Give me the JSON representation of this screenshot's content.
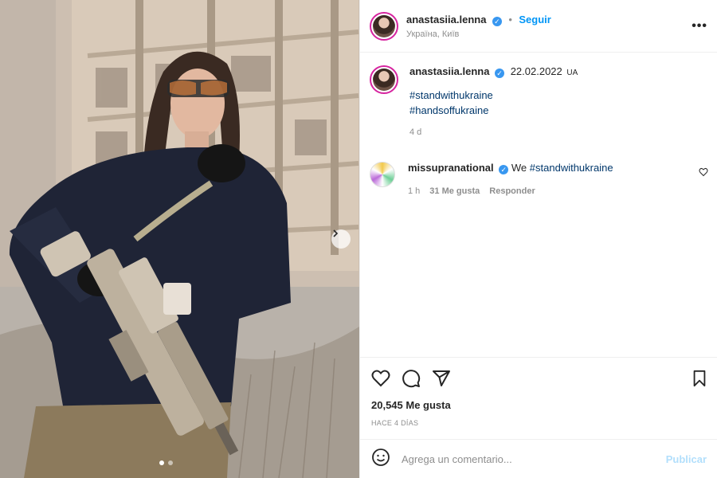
{
  "header": {
    "username": "anastasiia.lenna",
    "separator": "•",
    "follow_label": "Seguir",
    "location": "Україна, Київ",
    "more_label": "•••"
  },
  "caption": {
    "username": "anastasiia.lenna",
    "date": "22.02.2022",
    "flag": "UA",
    "hashtags": [
      "#standwithukraine",
      "#handsoffukraine"
    ],
    "age": "4 d"
  },
  "comment": {
    "username": "missupranational",
    "text_prefix": "We ",
    "hashtag": "#standwithukraine",
    "time": "1 h",
    "likes": "31 Me gusta",
    "reply_label": "Responder"
  },
  "actions": {
    "like_icon": "heart-icon",
    "comment_icon": "comment-icon",
    "share_icon": "share-icon",
    "save_icon": "bookmark-icon"
  },
  "stats": {
    "likes": "20,545 Me gusta",
    "posted": "HACE 4 DÍAS"
  },
  "add_comment": {
    "placeholder": "Agrega un comentario...",
    "post_label": "Publicar",
    "emoji_icon": "emoji-icon"
  },
  "media": {
    "carousel_dots": 2,
    "active_dot": 0
  },
  "colors": {
    "accent": "#0095f6",
    "verified": "#3897f0",
    "link": "#00376b",
    "muted": "#8e8e8e"
  }
}
